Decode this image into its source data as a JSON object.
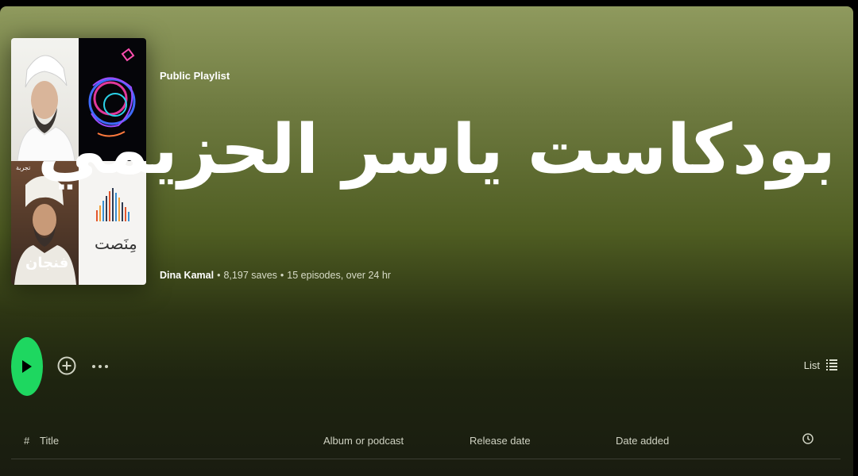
{
  "playlist": {
    "type_label": "Public Playlist",
    "title": "بودكاست ياسر الحزيمي",
    "owner": "Dina Kamal",
    "saves": "8,197 saves",
    "episodes": "15 episodes, over 24 hr",
    "separator": "•",
    "cover_texts": {
      "tile3_top": "تجربة",
      "tile3_bottom": "فنجان",
      "tile4_logo": "مِنَصت"
    }
  },
  "actions": {
    "view_label": "List"
  },
  "table": {
    "headers": {
      "number": "#",
      "title": "Title",
      "album": "Album or podcast",
      "release_date": "Release date",
      "date_added": "Date added"
    }
  },
  "colors": {
    "accent": "#1ed760",
    "header_gradient_top": "#8f9a5e",
    "background_bottom": "#191c10"
  },
  "icons": [
    "play-icon",
    "add-circle-icon",
    "more-options-icon",
    "list-view-icon",
    "clock-icon"
  ]
}
